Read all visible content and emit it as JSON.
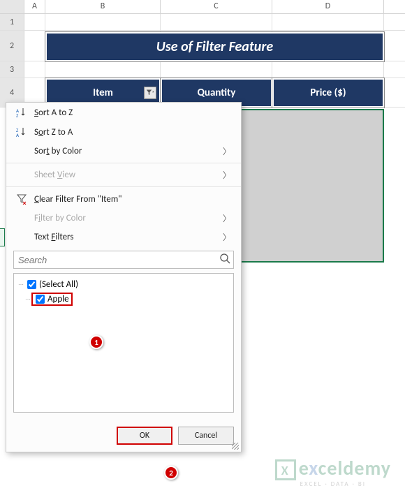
{
  "columns": {
    "A": "A",
    "B": "B",
    "C": "C",
    "D": "D"
  },
  "rows": {
    "r1": "1",
    "r2": "2",
    "r3": "3",
    "r4": "4"
  },
  "title": "Use of Filter Feature",
  "headers": {
    "item": "Item",
    "quantity": "Quantity",
    "price": "Price ($)"
  },
  "menu": {
    "sort_az": "Sort A to Z",
    "sort_za": "Sort Z to A",
    "sort_color": "Sort by Color",
    "sheet_view": "Sheet View",
    "clear_filter": "Clear Filter From \"Item\"",
    "filter_color": "Filter by Color",
    "text_filters": "Text Filters",
    "search_placeholder": "Search",
    "select_all": "(Select All)",
    "apple": "Apple",
    "ok": "OK",
    "cancel": "Cancel"
  },
  "callouts": {
    "one": "1",
    "two": "2"
  },
  "watermark": {
    "brand_pre": "e",
    "brand_x": "x",
    "brand_post": "celdemy",
    "tag": "EXCEL · DATA · BI"
  }
}
